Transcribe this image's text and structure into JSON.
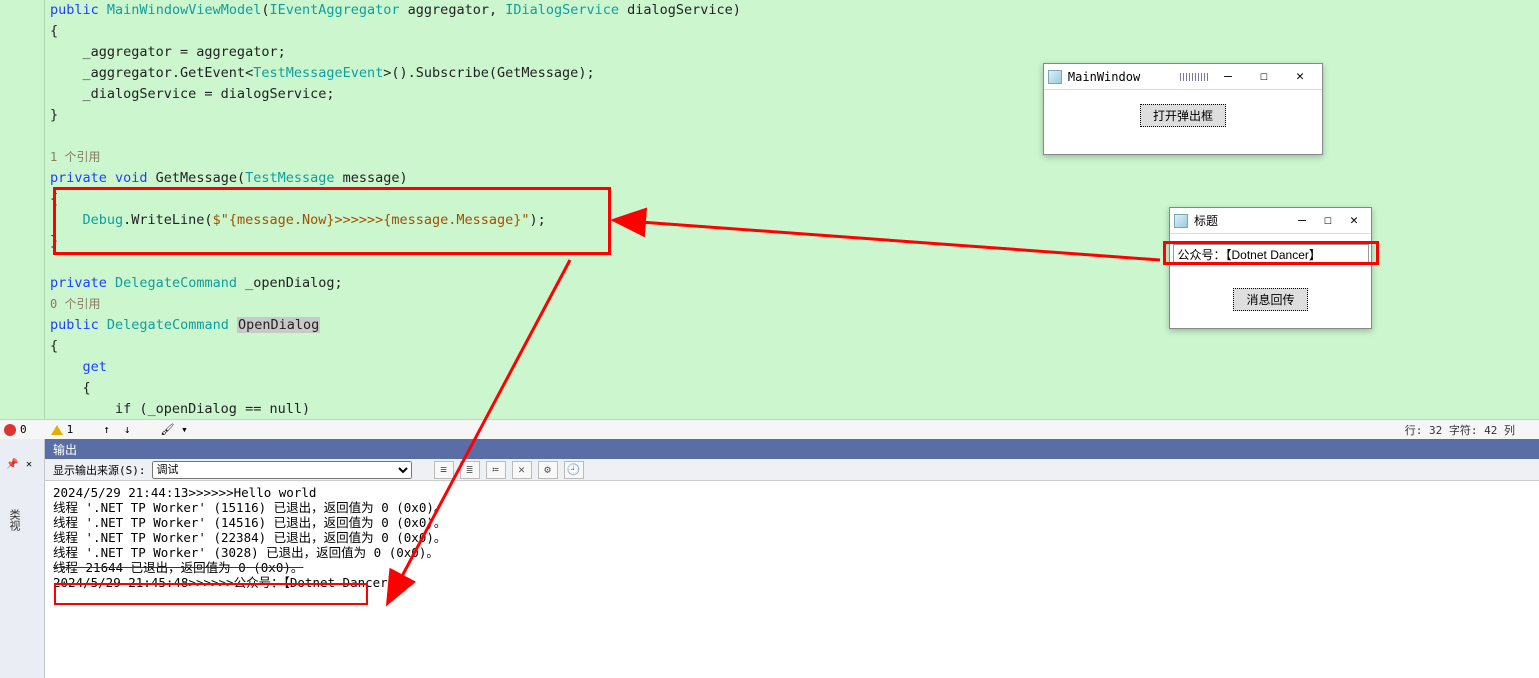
{
  "code": {
    "line1_public": "public",
    "line1_ctor": "MainWindowViewModel",
    "line1_rest_a": "(",
    "line1_ieagg": "IEventAggregator",
    "line1_rest_b": " aggregator, ",
    "line1_idlg": "IDialogService",
    "line1_rest_c": " dialogService)",
    "line2": "{",
    "line3": "    _aggregator = aggregator;",
    "line4a": "    _aggregator.GetEvent<",
    "line4b": "TestMessageEvent",
    "line4c": ">().Subscribe(GetMessage);",
    "line5": "    _dialogService = dialogService;",
    "line6": "}",
    "ref1": "1 个引用",
    "line7_priv": "private",
    "line7_void": " void",
    "line7_name": " GetMessage(",
    "line7_type": "TestMessage",
    "line7_end": " message)",
    "line8": "{",
    "line9a": "    Debug",
    "line9b": ".WriteLine(",
    "line9c": "$\"{message.Now}>>>>>>{message.Message}\"",
    "line9d": ");",
    "line10": "}",
    "line11_priv": "private",
    "line11_type": "DelegateCommand",
    "line11_name": " _openDialog;",
    "ref0": "0 个引用",
    "line12_pub": "public",
    "line12_type": "DelegateCommand",
    "line12_name": "OpenDialog",
    "line13": "{",
    "line14": "    get",
    "line15": "    {",
    "line16": "        if (_openDialog == null)"
  },
  "status": {
    "err": "0",
    "warn": "1",
    "linecol": "行: 32    字符: 42    列"
  },
  "tooltab": {
    "label": "类视"
  },
  "output": {
    "title": "输出",
    "src_label": "显示输出来源(S):",
    "src_selected": "调试",
    "lines": [
      "2024/5/29 21:44:13>>>>>>Hello world",
      "线程 '.NET TP Worker' (15116) 已退出，返回值为 0 (0x0)。",
      "线程 '.NET TP Worker' (14516) 已退出，返回值为 0 (0x0)。",
      "线程 '.NET TP Worker' (22384) 已退出，返回值为 0 (0x0)。",
      "线程 '.NET TP Worker' (3028) 已退出，返回值为 0 (0x0)。",
      "线程 21644 已退出，返回值为 0 (0x0)。",
      "2024/5/29 21:45:48>>>>>>公众号：【Dotnet Dancer】"
    ]
  },
  "mainwin": {
    "title": "MainWindow",
    "button": "打开弹出框"
  },
  "dialog": {
    "title": "标题",
    "textbox": "公众号：【Dotnet Dancer】",
    "button": "消息回传"
  }
}
